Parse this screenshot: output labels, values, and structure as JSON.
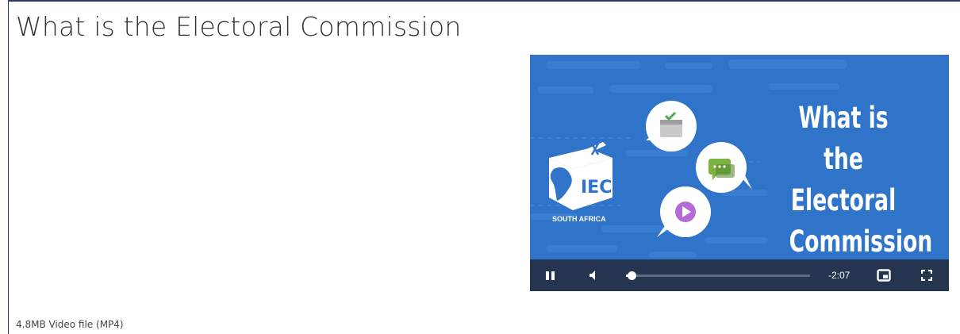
{
  "page": {
    "title": "What is the Electoral Commission",
    "file_info": "4.8MB Video file (MP4)"
  },
  "video": {
    "thumbnail": {
      "logo_text": "IEC",
      "logo_subtext": "SOUTH AFRICA",
      "title_lines": [
        "What is the",
        "Electoral",
        "Commission"
      ],
      "background_color": "#2f74c8"
    },
    "controls": {
      "play_state": "playing",
      "pause_icon": "pause-icon",
      "mute_icon": "volume-icon",
      "progress_fraction": 0.03,
      "time_remaining": "-2:07",
      "pip_icon": "picture-in-picture-icon",
      "fullscreen_icon": "fullscreen-icon",
      "bar_color": "#25354f"
    }
  },
  "colors": {
    "frame_border": "#2b3a67",
    "title_text": "#333333"
  }
}
